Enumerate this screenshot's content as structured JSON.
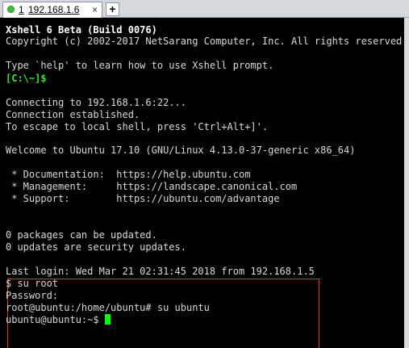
{
  "tab": {
    "number": "1",
    "host": "192.168.1.6",
    "close_glyph": "×",
    "status_color": "#3cc23c"
  },
  "new_tab_glyph": "+",
  "terminal": {
    "lines": [
      "Xshell 6 Beta (Build 0076)",
      "Copyright (c) 2002-2017 NetSarang Computer, Inc. All rights reserved.",
      "",
      "Type `help' to learn how to use Xshell prompt.",
      "[C:\\~]$",
      "",
      "Connecting to 192.168.1.6:22...",
      "Connection established.",
      "To escape to local shell, press 'Ctrl+Alt+]'.",
      "",
      "Welcome to Ubuntu 17.10 (GNU/Linux 4.13.0-37-generic x86_64)",
      "",
      " * Documentation:  https://help.ubuntu.com",
      " * Management:     https://landscape.canonical.com",
      " * Support:        https://ubuntu.com/advantage",
      "",
      "",
      "0 packages can be updated.",
      "0 updates are security updates.",
      "",
      "Last login: Wed Mar 21 02:31:45 2018 from 192.168.1.5",
      "$ su root",
      "Password:",
      "root@ubuntu:/home/ubuntu# su ubuntu",
      "ubuntu@ubuntu:~$ "
    ]
  },
  "colors": {
    "background": "#000000",
    "text": "#d8d8d8",
    "prompt": "#39e639",
    "cursor": "#00ff00",
    "highlight_border": "#d33a3a"
  }
}
